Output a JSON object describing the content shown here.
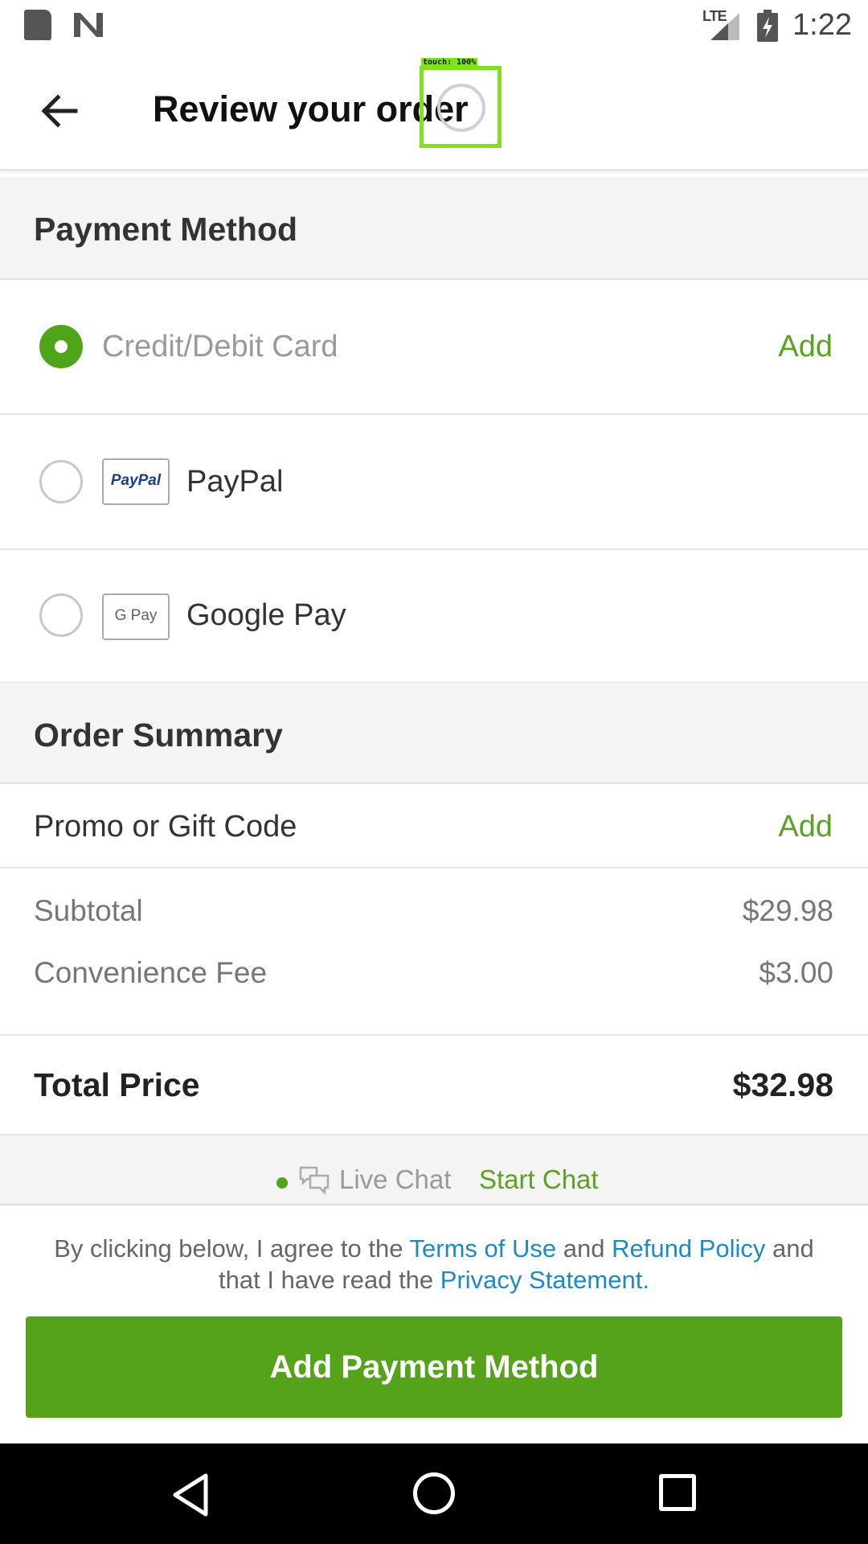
{
  "status_bar": {
    "network": "LTE",
    "time": "1:22",
    "icons": [
      "sd-card-icon",
      "n-logo-icon",
      "signal-icon",
      "battery-charging-icon"
    ]
  },
  "app_bar": {
    "title": "Review your order",
    "touch_label": "touch: 100%",
    "icons": [
      "back-arrow-icon",
      "loading-spinner-icon"
    ]
  },
  "payment": {
    "header": "Payment Method",
    "options": [
      {
        "label": "Credit/Debit Card",
        "selected": true,
        "action": "Add"
      },
      {
        "label": "PayPal",
        "selected": false,
        "logo_text": "PayPal"
      },
      {
        "label": "Google Pay",
        "selected": false,
        "logo_text": "G Pay"
      }
    ]
  },
  "summary": {
    "header": "Order Summary",
    "promo_label": "Promo or Gift Code",
    "promo_action": "Add",
    "subtotal_label": "Subtotal",
    "subtotal_value": "$29.98",
    "fee_label": "Convenience Fee",
    "fee_value": "$3.00",
    "total_label": "Total Price",
    "total_value": "$32.98"
  },
  "chat": {
    "live_label": "Live Chat",
    "start_label": "Start Chat"
  },
  "footer": {
    "legal_1": "By clicking below, I agree to the ",
    "terms": "Terms of Use",
    "legal_2": " and ",
    "refund": "Refund Policy",
    "legal_3": " and that I have read the ",
    "privacy": "Privacy Statement",
    "legal_4": ".",
    "cta": "Add Payment Method"
  },
  "colors": {
    "accent_green": "#55a31b",
    "link_blue": "#1d8ac6",
    "section_bg": "#f4f4f4"
  }
}
